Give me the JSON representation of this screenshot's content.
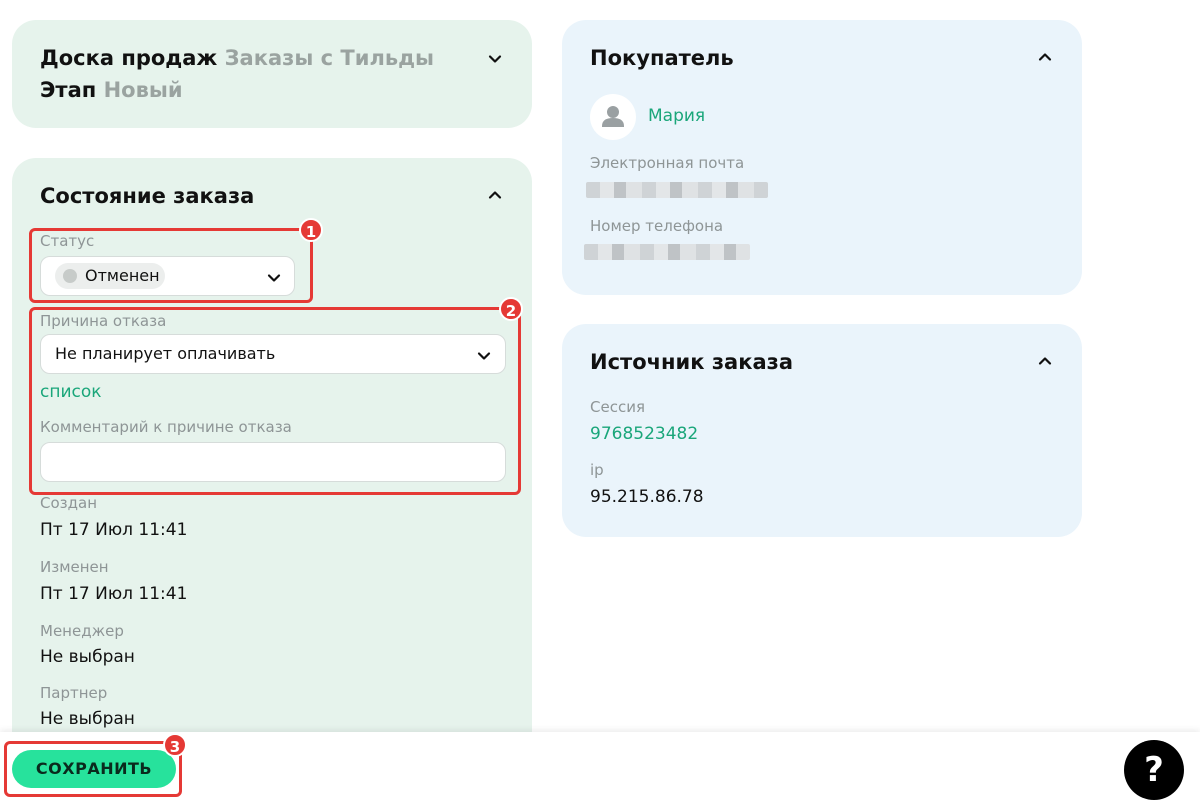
{
  "board_card": {
    "board_label": "Доска продаж",
    "board_value": "Заказы с Тильды",
    "stage_label": "Этап",
    "stage_value": "Новый"
  },
  "order_state": {
    "title": "Состояние заказа",
    "status_label": "Статус",
    "status_value": "Отменен",
    "reason_label": "Причина отказа",
    "reason_value": "Не планирует оплачивать",
    "list_link": "список",
    "comment_label": "Комментарий к причине отказа",
    "comment_value": "",
    "created_label": "Создан",
    "created_value": "Пт 17 Июл 11:41",
    "modified_label": "Изменен",
    "modified_value": "Пт 17 Июл 11:41",
    "manager_label": "Менеджер",
    "manager_value": "Не выбран",
    "partner_label": "Партнер",
    "partner_value": "Не выбран"
  },
  "buyer": {
    "title": "Покупатель",
    "name": "Мария",
    "email_label": "Электронная почта",
    "phone_label": "Номер телефона"
  },
  "source": {
    "title": "Источник заказа",
    "session_label": "Сессия",
    "session_value": "9768523482",
    "ip_label": "ip",
    "ip_value": "95.215.86.78"
  },
  "annotations": {
    "one": "1",
    "two": "2",
    "three": "3"
  },
  "footer": {
    "save_label": "СОХРАНИТЬ",
    "help_label": "?"
  },
  "colors": {
    "accent": "#27e29c",
    "link": "#1aa67a",
    "annotation": "#e53935"
  },
  "icons": [
    "chevron-down-icon",
    "chevron-up-icon",
    "user-icon",
    "help-icon"
  ]
}
